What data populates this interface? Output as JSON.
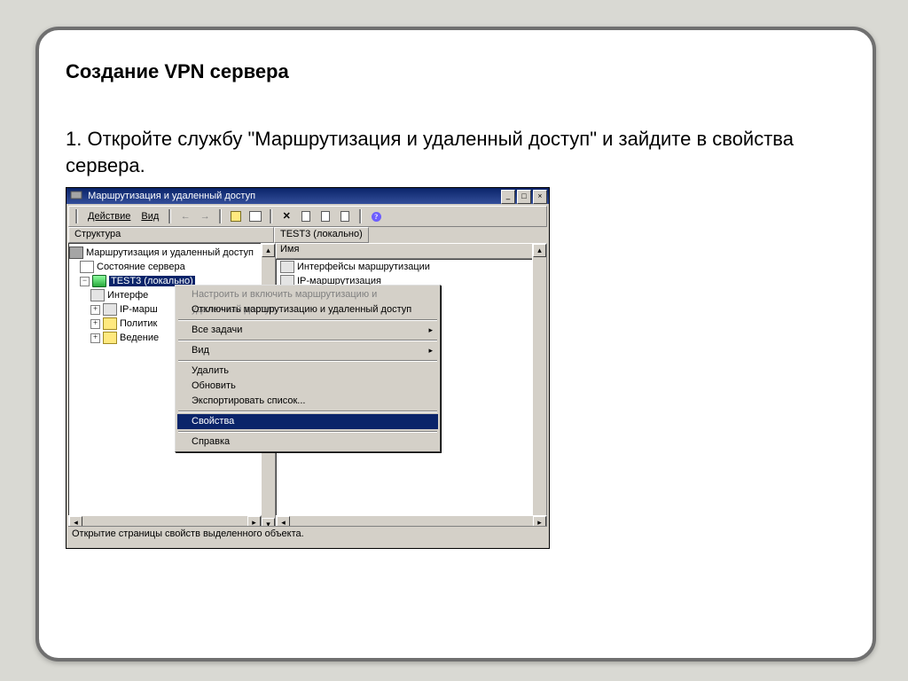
{
  "slide": {
    "heading": "Создание VPN сервера",
    "paragraph": "1. Откройте службу \"Маршрутизация и удаленный доступ\" и зайдите в свойства сервера."
  },
  "mmc": {
    "title": "Маршрутизация и удаленный доступ",
    "window_buttons": {
      "min": "_",
      "max": "□",
      "close": "×"
    },
    "menubar": {
      "action": "Действие",
      "view": "Вид"
    },
    "left_header": "Структура",
    "right_header": "TEST3 (локально)",
    "right_subcol": "Имя",
    "tree": {
      "root": "Маршрутизация и удаленный доступ",
      "state": "Состояние сервера",
      "server": "TEST3 (локально)",
      "items": [
        "Интерфе",
        "IP-марш",
        "Политик",
        "Ведение"
      ]
    },
    "right_items": [
      "Интерфейсы маршрутизации",
      "IP-маршрутизация"
    ],
    "status": "Открытие страницы свойств выделенного объекта."
  },
  "ctx": {
    "configure": "Настроить и включить маршрутизацию и удаленный доступ",
    "disable": "Отключить маршрутизацию и удаленный доступ",
    "alltasks": "Все задачи",
    "view": "Вид",
    "delete": "Удалить",
    "refresh": "Обновить",
    "export": "Экспортировать список...",
    "props": "Свойства",
    "help": "Справка"
  }
}
